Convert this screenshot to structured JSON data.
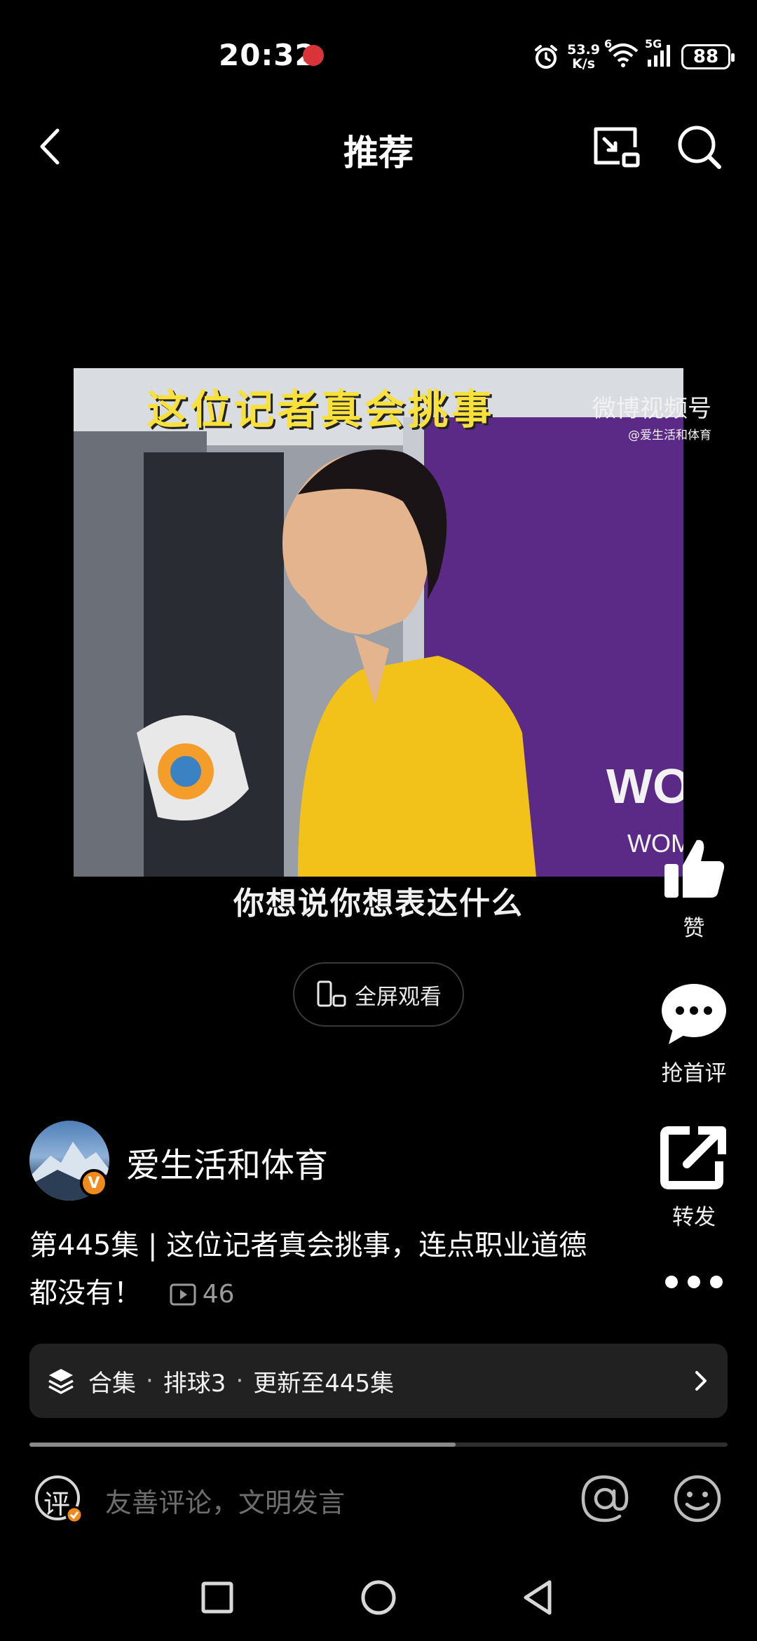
{
  "status_bar": {
    "time": "20:32",
    "net_speed_value": "53.9",
    "net_speed_unit": "K/s",
    "wifi_badge": "6",
    "cell_badge": "5G",
    "battery": "88"
  },
  "nav": {
    "title": "推荐",
    "back_icon": "chevron-left-icon",
    "cast_icon": "screen-cast-icon",
    "search_icon": "search-icon"
  },
  "video": {
    "headline": "这位记者真会挑事",
    "watermark": "微博视频号",
    "watermark_handle": "@爱生活和体育",
    "caption": "你想说你想表达什么",
    "fullscreen_label": "全屏观看"
  },
  "actions": {
    "like_label": "赞",
    "comment_label": "抢首评",
    "share_label": "转发"
  },
  "author": {
    "name": "爱生活和体育",
    "verified_badge": "V"
  },
  "post": {
    "title": "第445集 | 这位记者真会挑事，连点职业道德都没有！",
    "views": "46"
  },
  "collection": {
    "label": "合集",
    "series": "排球3",
    "update": "更新至445集"
  },
  "progress": {
    "fraction": 0.61
  },
  "comment_bar": {
    "icon_text": "评",
    "placeholder": "友善评论，文明发言"
  },
  "colors": {
    "background": "#000000",
    "headline_yellow": "#f7e13a",
    "badge_orange": "#f08a1c",
    "collection_bg": "#212121"
  }
}
